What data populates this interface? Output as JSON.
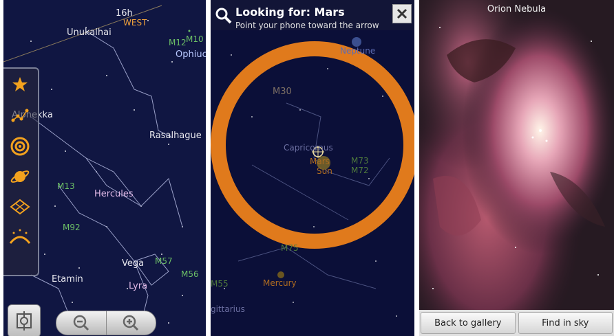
{
  "panel1": {
    "labels": {
      "hour": "16h",
      "west": "WEST",
      "unukalhai": "Unukalhai",
      "m12": "M12",
      "m10": "M10",
      "ophiuc": "Ophiuc",
      "alphekka": "Alphekka",
      "rasalhague": "Rasalhague",
      "m13": "M13",
      "hercules": "Hercules",
      "m92": "M92",
      "vega": "Vega",
      "m57": "M57",
      "m56": "M56",
      "etamin": "Etamin",
      "lyra": "Lyra"
    },
    "toolbar_icons": [
      "star-icon",
      "constellation-icon",
      "galaxy-icon",
      "planet-icon",
      "grid-icon",
      "horizon-icon"
    ]
  },
  "panel2": {
    "search": {
      "title": "Looking for: Mars",
      "subtitle": "Point your phone toward the arrow"
    },
    "labels": {
      "neptune": "Neptune",
      "m30": "M30",
      "capricornus": "Capricornus",
      "mars": "Mars",
      "sun": "Sun",
      "m73": "M73",
      "m72": "M72",
      "m75": "M75",
      "m55": "M55",
      "mercury": "Mercury",
      "sagittarius": "gittarius"
    }
  },
  "panel3": {
    "title": "Orion Nebula",
    "buttons": {
      "back": "Back to gallery",
      "find": "Find in sky"
    }
  },
  "colors": {
    "sky_background": "#101642",
    "ring": "#e07a1c",
    "planet_label": "#f0a13a",
    "messier_label": "#6cbf66",
    "constellation_label": "#e0b9e6"
  }
}
